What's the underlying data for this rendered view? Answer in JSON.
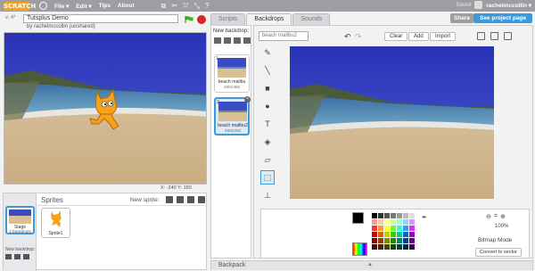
{
  "topbar": {
    "logo": "SCRATCH",
    "menus": [
      "File ▾",
      "Edit ▾",
      "Tips",
      "About"
    ],
    "saved": "Saved",
    "username": "rachelmccollin ▾"
  },
  "stage_header": {
    "version": "v. 4*",
    "project_title": "Tutsplus Demo",
    "owner": "by rachelmccollin (unshared)"
  },
  "stage": {
    "coords": "X: -240  Y: 180"
  },
  "sprites_panel": {
    "title": "Sprites",
    "new_sprite": "New sprite:",
    "stage_label": "Stage",
    "stage_sub": "2 backdrops",
    "new_backdrop": "New backdrop:",
    "sprite1": "Sprite1"
  },
  "tabs": [
    {
      "label": "Scripts"
    },
    {
      "label": "Backdrops"
    },
    {
      "label": "Sounds"
    }
  ],
  "share_label": "Share",
  "see_project": "See project page",
  "backdrop_list": {
    "label": "New backdrop:",
    "items": [
      {
        "num": "1",
        "name": "beach malibu",
        "size": "480x360"
      },
      {
        "num": "2",
        "name": "beach malibu2",
        "size": "480x360"
      }
    ]
  },
  "editor": {
    "backdrop_name": "beach malibu2",
    "clear": "Clear",
    "add": "Add",
    "import": "Import",
    "zoom": "100%",
    "mode": "Bitmap Mode",
    "convert": "Convert to vector"
  },
  "backpack": {
    "label": "Backpack"
  },
  "palette_colors": [
    "#000000",
    "#333333",
    "#555555",
    "#777777",
    "#999999",
    "#bbbbbb",
    "#dddddd",
    "#ff9999",
    "#ffcc99",
    "#ffff99",
    "#ccff99",
    "#99ffcc",
    "#99ccff",
    "#cc99ff",
    "#ff3333",
    "#ff9933",
    "#ffff33",
    "#66ff33",
    "#33ffcc",
    "#3399ff",
    "#cc33ff",
    "#cc0000",
    "#cc6600",
    "#cccc00",
    "#33cc00",
    "#00cc99",
    "#0066cc",
    "#9900cc",
    "#880000",
    "#884400",
    "#888800",
    "#228800",
    "#008866",
    "#004488",
    "#660088",
    "#440000",
    "#442200",
    "#444400",
    "#114400",
    "#004433",
    "#002244",
    "#330044"
  ]
}
